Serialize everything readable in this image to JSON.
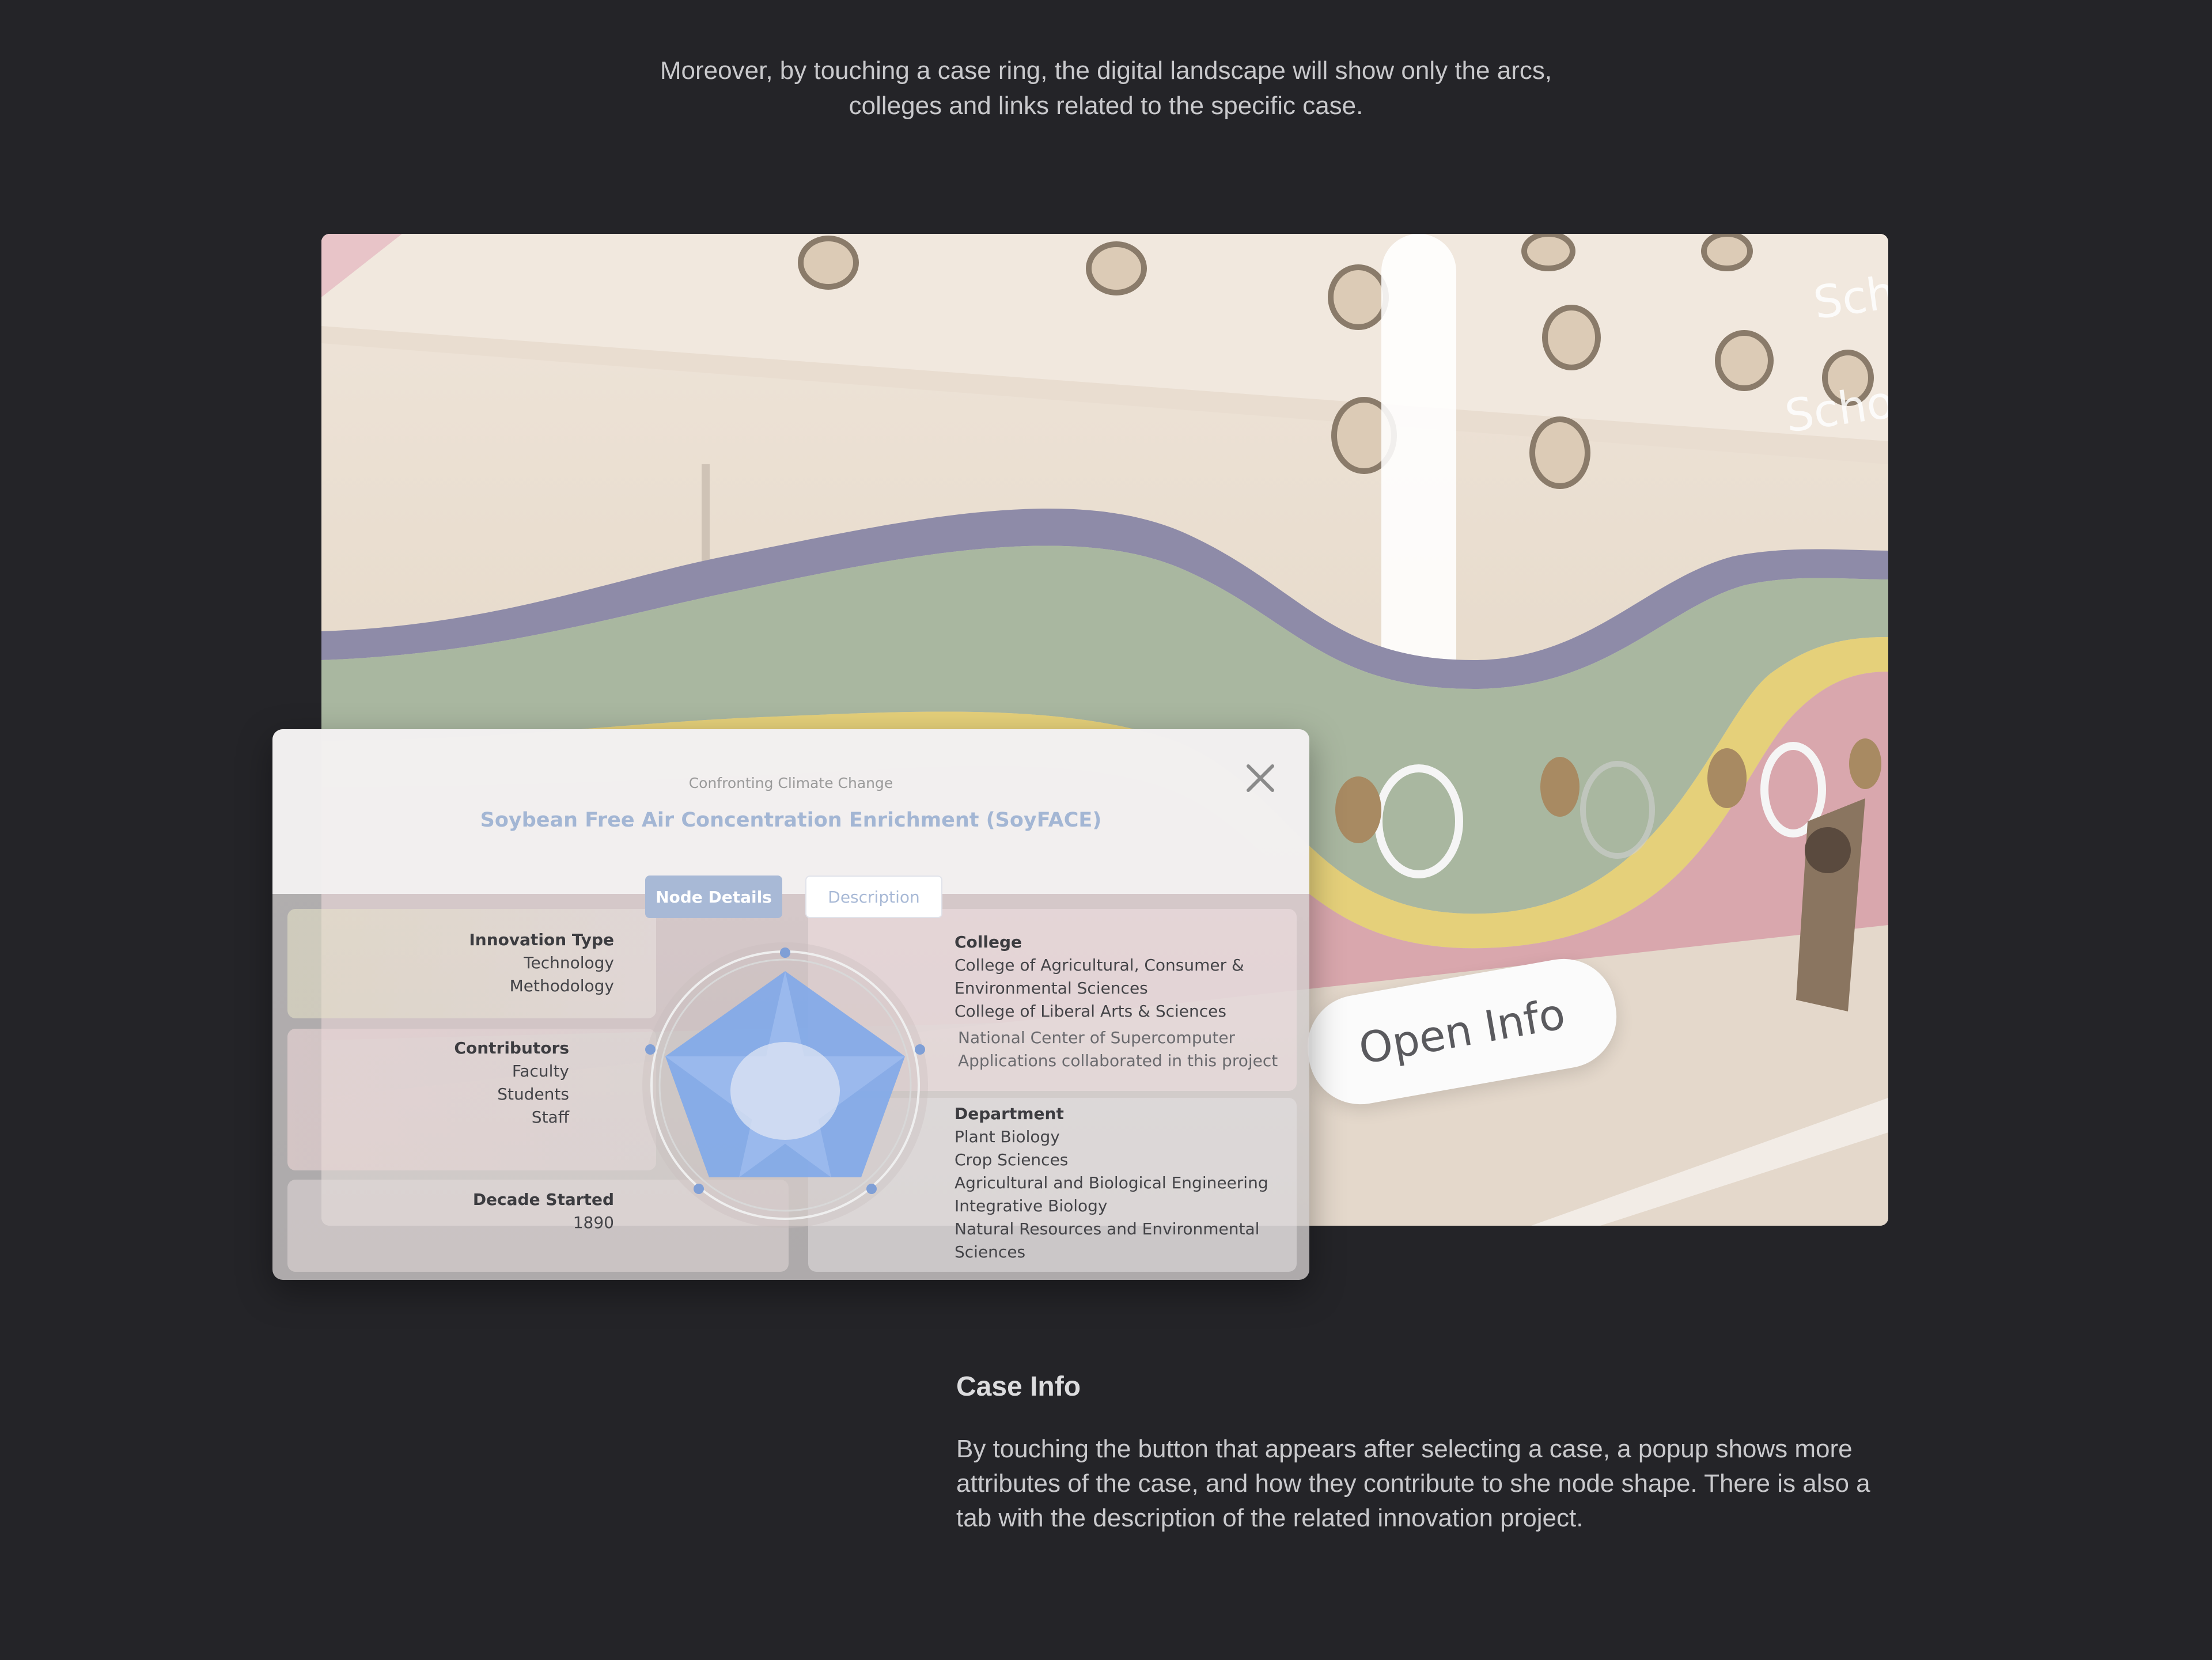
{
  "intro": {
    "line1": "Moreover, by touching a case ring, the digital landscape will show only the arcs,",
    "line2": "colleges and links related to the specific case."
  },
  "photo": {
    "school_label_1": "Schoo",
    "school_label_2": "School o",
    "open_info_label": "Open Info"
  },
  "popup": {
    "subtitle": "Confronting Climate Change",
    "title": "Soybean Free Air Concentration Enrichment (SoyFACE)",
    "close_icon": "close-icon",
    "tabs": [
      {
        "label": "Node Details",
        "active": true
      },
      {
        "label": "Description",
        "active": false
      }
    ],
    "innovation_type": {
      "heading": "Innovation Type",
      "items": [
        "Technology",
        "Methodology"
      ]
    },
    "contributors": {
      "heading": "Contributors",
      "items": [
        "Faculty",
        "Students",
        "Staff"
      ]
    },
    "decade_started": {
      "heading": "Decade Started",
      "value": "1890"
    },
    "college": {
      "heading": "College",
      "items": [
        "College of Agricultural, Consumer &",
        "Environmental Sciences",
        "College of Liberal Arts & Sciences"
      ],
      "note_line1": "National Center of Supercomputer",
      "note_line2": "Applications collaborated in this project"
    },
    "department": {
      "heading": "Department",
      "items": [
        "Plant Biology",
        "Crop Sciences",
        "Agricultural and Biological Engineering",
        "Integrative Biology",
        "Natural Resources and Environmental",
        "Sciences"
      ]
    },
    "node_shape_color": "#7fa8ea"
  },
  "case_info": {
    "title": "Case Info",
    "body": "By touching the button that appears after selecting a case, a popup shows more attributes of the case, and how they contribute to she node shape. There is also a tab with the description of the related innovation project."
  }
}
